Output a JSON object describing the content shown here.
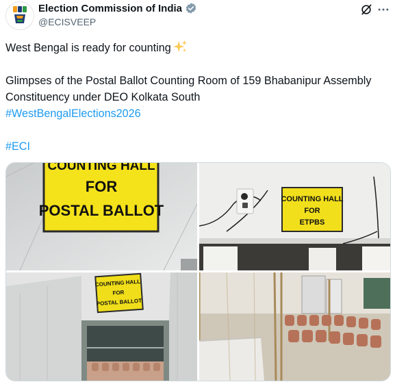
{
  "account": {
    "name": "Election Commission of India",
    "handle": "@ECISVEEP",
    "verified_badge_color": "#829aab",
    "avatar_icon": "eci-logo-icon"
  },
  "actions": {
    "grok_icon": "grok-icon",
    "more_icon": "more-options-icon"
  },
  "post": {
    "line1": "West Bengal is ready for counting",
    "line1_emoji": "sparkles-icon",
    "line2": "Glimpses of the Postal Ballot Counting Room of 159 Bhabanipur Assembly Constituency under DEO Kolkata South",
    "hashtag1": "#WestBengalElections2026",
    "hashtag2": "#ECI",
    "link_color": "#1d9bf0"
  },
  "media": {
    "photo1": {
      "sign_line1": "COUNTING HALL",
      "sign_line2": "FOR",
      "sign_line3": "POSTAL BALLOT"
    },
    "photo2": {
      "sign_line1": "COUNTING HALL",
      "sign_line2": "FOR",
      "sign_line3": "ETPBS"
    },
    "photo3": {
      "sign_line1": "COUNTING HALL",
      "sign_line2": "FOR",
      "sign_line3": "POSTAL BALLOT"
    },
    "photo4": {}
  }
}
